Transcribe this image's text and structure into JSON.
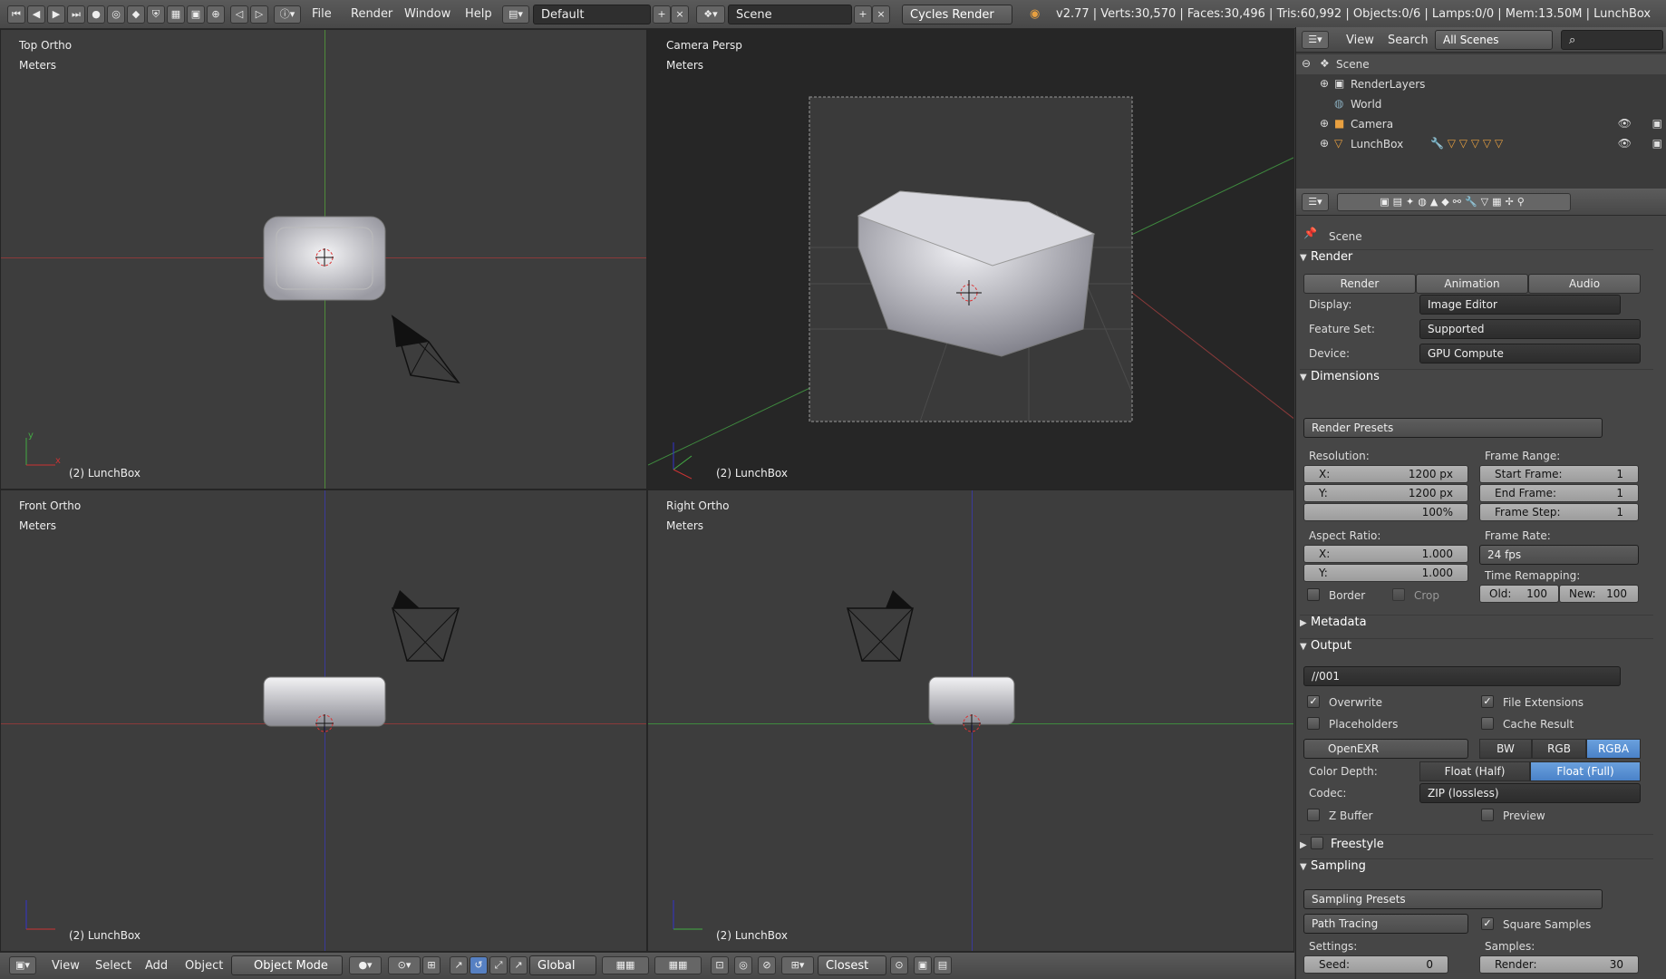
{
  "topbar": {
    "menus": [
      "File",
      "Render",
      "Window",
      "Help"
    ],
    "layout": "Default",
    "scene": "Scene",
    "engine": "Cycles Render",
    "stats": "v2.77 | Verts:30,570 | Faces:30,496 | Tris:60,992 | Objects:0/6 | Lamps:0/0 | Mem:13.50M | LunchBox"
  },
  "viewports": {
    "top": {
      "title": "Top Ortho",
      "units": "Meters",
      "footer": "(2) LunchBox"
    },
    "camera": {
      "title": "Camera Persp",
      "units": "Meters",
      "footer": "(2) LunchBox"
    },
    "front": {
      "title": "Front Ortho",
      "units": "Meters",
      "footer": "(2) LunchBox"
    },
    "right": {
      "title": "Right Ortho",
      "units": "Meters",
      "footer": "(2) LunchBox"
    }
  },
  "bottombar": {
    "view": "View",
    "select": "Select",
    "add": "Add",
    "object": "Object",
    "mode": "Object Mode",
    "orientation": "Global",
    "snap": "Closest"
  },
  "outliner": {
    "view": "View",
    "search": "Search",
    "filter": "All Scenes",
    "items": [
      "Scene",
      "RenderLayers",
      "World",
      "Camera",
      "LunchBox"
    ]
  },
  "props": {
    "context": "Scene",
    "render": {
      "title": "Render",
      "buttons": [
        "Render",
        "Animation",
        "Audio"
      ],
      "display_label": "Display:",
      "display": "Image Editor",
      "feature_label": "Feature Set:",
      "feature": "Supported",
      "device_label": "Device:",
      "device": "GPU Compute"
    },
    "dimensions": {
      "title": "Dimensions",
      "presets": "Render Presets",
      "resolution": "Resolution:",
      "x": "X:",
      "x_val": "1200 px",
      "y": "Y:",
      "y_val": "1200 px",
      "pct": "100%",
      "aspect": "Aspect Ratio:",
      "ax": "X:",
      "ax_val": "1.000",
      "ay": "Y:",
      "ay_val": "1.000",
      "border": "Border",
      "crop": "Crop",
      "frame_range": "Frame Range:",
      "start": "Start Frame:",
      "start_val": "1",
      "end": "End Frame:",
      "end_val": "1",
      "step": "Frame Step:",
      "step_val": "1",
      "frame_rate": "Frame Rate:",
      "fps": "24 fps",
      "remap": "Time Remapping:",
      "old": "Old:",
      "old_val": "100",
      "new": "New:",
      "new_val": "100"
    },
    "metadata": {
      "title": "Metadata"
    },
    "output": {
      "title": "Output",
      "path": "//001",
      "overwrite": "Overwrite",
      "file_ext": "File Extensions",
      "placeholders": "Placeholders",
      "cache": "Cache Result",
      "format": "OpenEXR",
      "bw": "BW",
      "rgb": "RGB",
      "rgba": "RGBA",
      "depth_label": "Color Depth:",
      "half": "Float (Half)",
      "full": "Float (Full)",
      "codec_label": "Codec:",
      "codec": "ZIP (lossless)",
      "zbuffer": "Z Buffer",
      "preview": "Preview"
    },
    "freestyle": {
      "title": "Freestyle"
    },
    "sampling": {
      "title": "Sampling",
      "presets": "Sampling Presets",
      "method": "Path Tracing",
      "square": "Square Samples",
      "settings": "Settings:",
      "samples": "Samples:",
      "seed": "Seed:",
      "seed_val": "0",
      "render": "Render:",
      "render_val": "30"
    }
  }
}
